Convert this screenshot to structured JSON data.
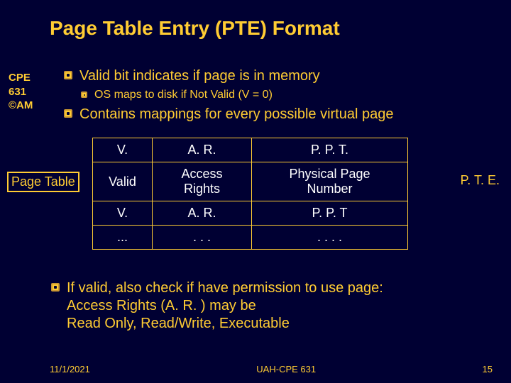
{
  "title": "Page Table Entry (PTE) Format",
  "sidebar": "CPE\n631\n©AM",
  "bullets": {
    "b1": "Valid bit indicates if page is in memory",
    "b1sub": "OS maps to disk if Not Valid  (V = 0)",
    "b2": "Contains mappings for every possible virtual page",
    "b3": "If valid, also check if have permission to use page:\nAccess Rights (A. R. ) may be\nRead Only, Read/Write, Executable"
  },
  "page_table_label": "Page Table",
  "pte_label": "P. T. E.",
  "table": {
    "r0c0": "V.",
    "r0c1": "A. R.",
    "r0c2": "P. P. T.",
    "r1c0": "Valid",
    "r1c1": "Access\nRights",
    "r1c2": "Physical Page\nNumber",
    "r2c0": "V.",
    "r2c1": "A. R.",
    "r2c2": "P. P. T",
    "r3c0": "...",
    "r3c1": ". . .",
    "r3c2": ". . . ."
  },
  "footer": {
    "date": "11/1/2021",
    "center": "UAH-CPE 631",
    "page": "15"
  }
}
